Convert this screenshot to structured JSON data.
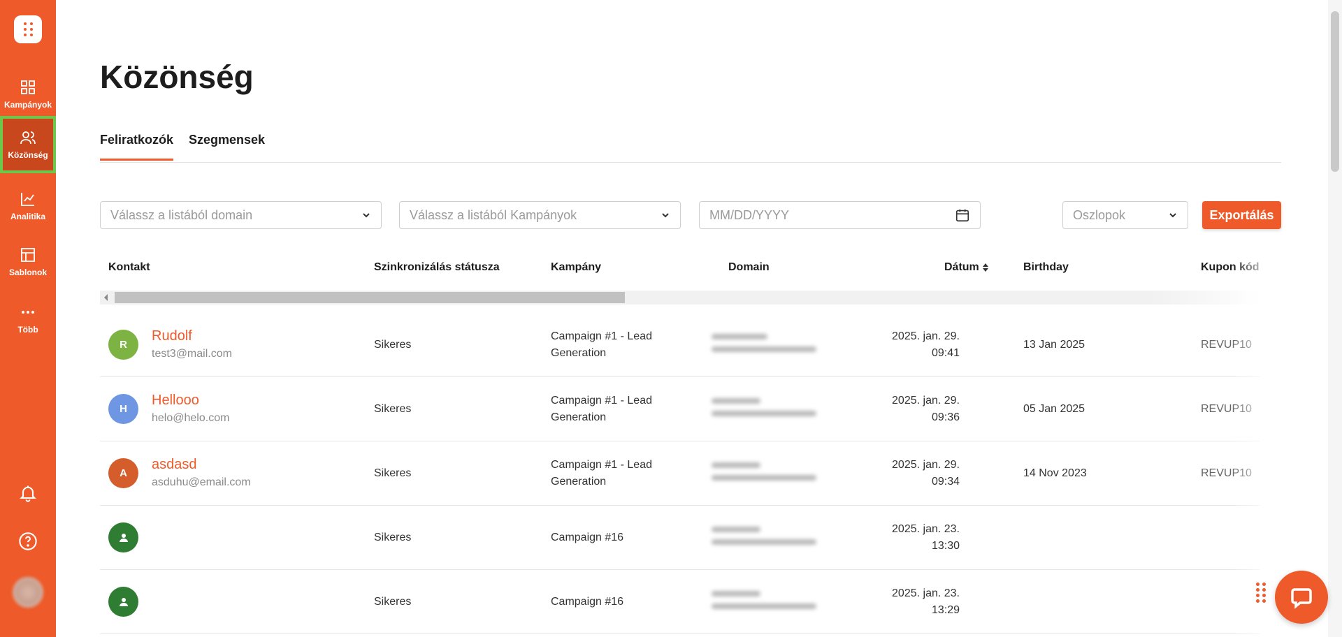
{
  "sidebar": {
    "items": [
      {
        "label": "Kampányok",
        "icon": "grid-icon"
      },
      {
        "label": "Közönség",
        "icon": "users-icon",
        "active": true
      },
      {
        "label": "Analitika",
        "icon": "chart-icon"
      },
      {
        "label": "Sablonok",
        "icon": "layout-icon"
      },
      {
        "label": "Több",
        "icon": "more-icon"
      }
    ],
    "bottom_icons": [
      "bell-icon",
      "help-icon",
      "avatar"
    ]
  },
  "page": {
    "title": "Közönség"
  },
  "tabs": [
    {
      "label": "Feliratkozók",
      "active": true
    },
    {
      "label": "Szegmensek",
      "active": false
    }
  ],
  "filters": {
    "domain_placeholder": "Válassz a listából domain",
    "campaign_placeholder": "Válassz a listából Kampányok",
    "date_placeholder": "MM/DD/YYYY",
    "columns_placeholder": "Oszlopok",
    "export_label": "Exportálás"
  },
  "table": {
    "headers": {
      "contact": "Kontakt",
      "sync": "Szinkronizálás státusza",
      "campaign": "Kampány",
      "domain": "Domain",
      "date": "Dátum",
      "birthday": "Birthday",
      "coupon": "Kupon kód"
    },
    "rows": [
      {
        "initial": "R",
        "name": "Rudolf",
        "email": "test3@mail.com",
        "sync": "Sikeres",
        "campaign_l1": "Campaign #1 - Lead",
        "campaign_l2": "Generation",
        "date_l1": "2025. jan. 29.",
        "date_l2": "09:41",
        "birthday": "13 Jan 2025",
        "coupon": "REVUP10",
        "avatar_color": "#7cb342"
      },
      {
        "initial": "H",
        "name": "Hellooo",
        "email": "helo@helo.com",
        "sync": "Sikeres",
        "campaign_l1": "Campaign #1 - Lead",
        "campaign_l2": "Generation",
        "date_l1": "2025. jan. 29.",
        "date_l2": "09:36",
        "birthday": "05 Jan 2025",
        "coupon": "REVUP10",
        "avatar_color": "#6f96e3"
      },
      {
        "initial": "A",
        "name": "asdasd",
        "email": "asduhu@email.com",
        "sync": "Sikeres",
        "campaign_l1": "Campaign #1 - Lead",
        "campaign_l2": "Generation",
        "date_l1": "2025. jan. 29.",
        "date_l2": "09:34",
        "birthday": "14 Nov 2023",
        "coupon": "REVUP10",
        "avatar_color": "#d45d2b"
      },
      {
        "initial": "",
        "name": "",
        "email": "",
        "sync": "Sikeres",
        "campaign_l1": "Campaign #16",
        "campaign_l2": "",
        "date_l1": "2025. jan. 23.",
        "date_l2": "13:30",
        "birthday": "",
        "coupon": "",
        "avatar_color": "#2e7d32"
      },
      {
        "initial": "",
        "name": "",
        "email": "",
        "sync": "Sikeres",
        "campaign_l1": "Campaign #16",
        "campaign_l2": "",
        "date_l1": "2025. jan. 23.",
        "date_l2": "13:29",
        "birthday": "",
        "coupon": "",
        "avatar_color": "#2e7d32"
      }
    ]
  },
  "colors": {
    "brand": "#ee5a29",
    "active_outline": "#6cc84a"
  }
}
